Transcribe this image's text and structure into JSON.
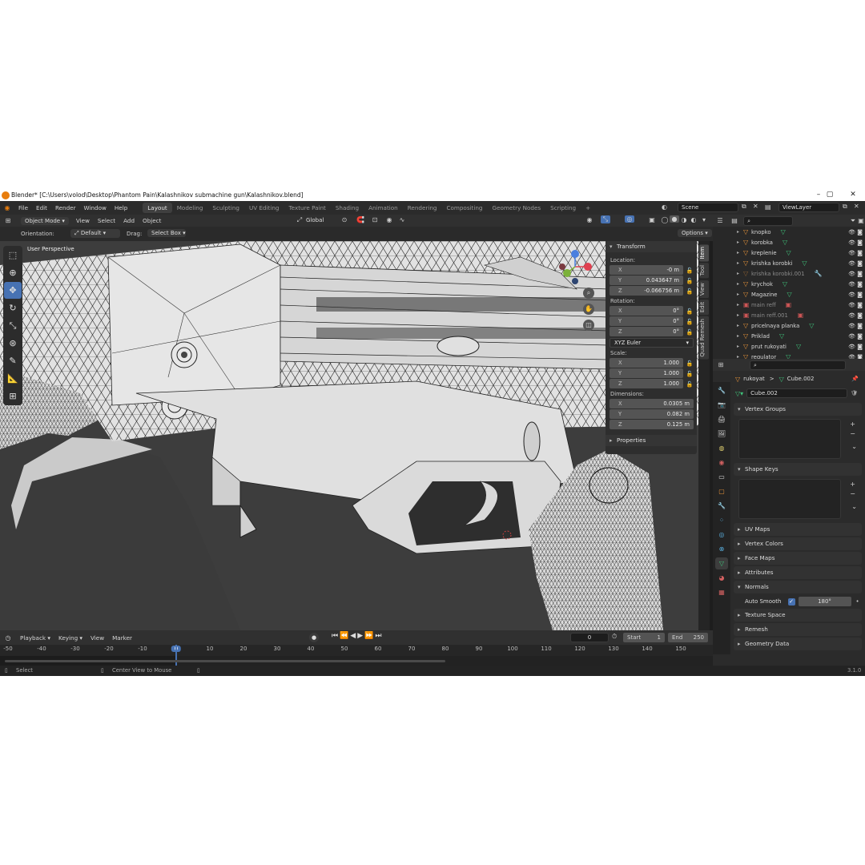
{
  "window": {
    "title": "Blender* [C:\\Users\\volod\\Desktop\\Phantom Pain\\Kalashnikov submachine gun\\Kalashnikov.blend]",
    "controls": [
      "–",
      "▢",
      "✕"
    ]
  },
  "menu": {
    "items": [
      "File",
      "Edit",
      "Render",
      "Window",
      "Help"
    ],
    "workspaces": [
      "Layout",
      "Modeling",
      "Sculpting",
      "UV Editing",
      "Texture Paint",
      "Shading",
      "Animation",
      "Rendering",
      "Compositing",
      "Geometry Nodes",
      "Scripting"
    ],
    "active_workspace": "Layout",
    "add_tab": "+",
    "scene": "Scene",
    "view_layer": "ViewLayer"
  },
  "viewport_header": {
    "mode": "Object Mode",
    "menus": [
      "View",
      "Select",
      "Add",
      "Object"
    ],
    "transform_orientation": "Global",
    "orientation_label": "Orientation:",
    "orientation_value": "Default",
    "drag_label": "Drag:",
    "drag_value": "Select Box",
    "options": "Options"
  },
  "viewport": {
    "perspective_label": "User Perspective",
    "accent_color": "#4772b3"
  },
  "npanel": {
    "transform_header": "Transform",
    "location_label": "Location:",
    "location": [
      [
        "X",
        "-0 m"
      ],
      [
        "Y",
        "0.043647 m"
      ],
      [
        "Z",
        "-0.066756 m"
      ]
    ],
    "rotation_label": "Rotation:",
    "rotation": [
      [
        "X",
        "0°"
      ],
      [
        "Y",
        "0°"
      ],
      [
        "Z",
        "0°"
      ]
    ],
    "rotation_mode": "XYZ Euler",
    "scale_label": "Scale:",
    "scale": [
      [
        "X",
        "1.000"
      ],
      [
        "Y",
        "1.000"
      ],
      [
        "Z",
        "1.000"
      ]
    ],
    "dimensions_label": "Dimensions:",
    "dimensions": [
      [
        "X",
        "0.0305 m"
      ],
      [
        "Y",
        "0.082 m"
      ],
      [
        "Z",
        "0.125 m"
      ]
    ],
    "properties_header": "Properties",
    "tabs": [
      "Item",
      "Tool",
      "View",
      "Edit",
      "Quad Remesh"
    ]
  },
  "outliner": {
    "rows": [
      {
        "name": "knopko",
        "dim": false
      },
      {
        "name": "korobka",
        "dim": false
      },
      {
        "name": "kreplenie",
        "dim": false
      },
      {
        "name": "krishka korobki",
        "dim": false
      },
      {
        "name": "krishka korobki.001",
        "dim": true
      },
      {
        "name": "krychok",
        "dim": false
      },
      {
        "name": "Magazine",
        "dim": false
      },
      {
        "name": "main reff",
        "dim": true
      },
      {
        "name": "main reff.001",
        "dim": true
      },
      {
        "name": "pricelnaya planka",
        "dim": false
      },
      {
        "name": "Priklad",
        "dim": false
      },
      {
        "name": "prut rukoyati",
        "dim": false
      },
      {
        "name": "regulator",
        "dim": false
      }
    ]
  },
  "properties": {
    "breadcrumb_object": "rukoyat",
    "breadcrumb_sep": ">",
    "breadcrumb_data": "Cube.002",
    "mesh_name": "Cube.002",
    "panels": {
      "vertex_groups": "Vertex Groups",
      "shape_keys": "Shape Keys",
      "uv_maps": "UV Maps",
      "vertex_colors": "Vertex Colors",
      "face_maps": "Face Maps",
      "attributes": "Attributes",
      "normals": "Normals",
      "texture_space": "Texture Space",
      "remesh": "Remesh",
      "geometry_data": "Geometry Data"
    },
    "auto_smooth_label": "Auto Smooth",
    "auto_smooth_checked": true,
    "auto_smooth_angle": "180°"
  },
  "timeline": {
    "menus": [
      "Playback",
      "Keying",
      "View",
      "Marker"
    ],
    "current_frame": "0",
    "start_label": "Start",
    "start": "1",
    "end_label": "End",
    "end": "250",
    "ticks": [
      "-50",
      "-40",
      "-30",
      "-20",
      "-10",
      "0",
      "10",
      "20",
      "30",
      "40",
      "50",
      "60",
      "70",
      "80",
      "90",
      "100",
      "110",
      "120",
      "130",
      "140",
      "150"
    ]
  },
  "statusbar": {
    "select": "Select",
    "center_view": "Center View to Mouse",
    "version": "3.1.0"
  }
}
